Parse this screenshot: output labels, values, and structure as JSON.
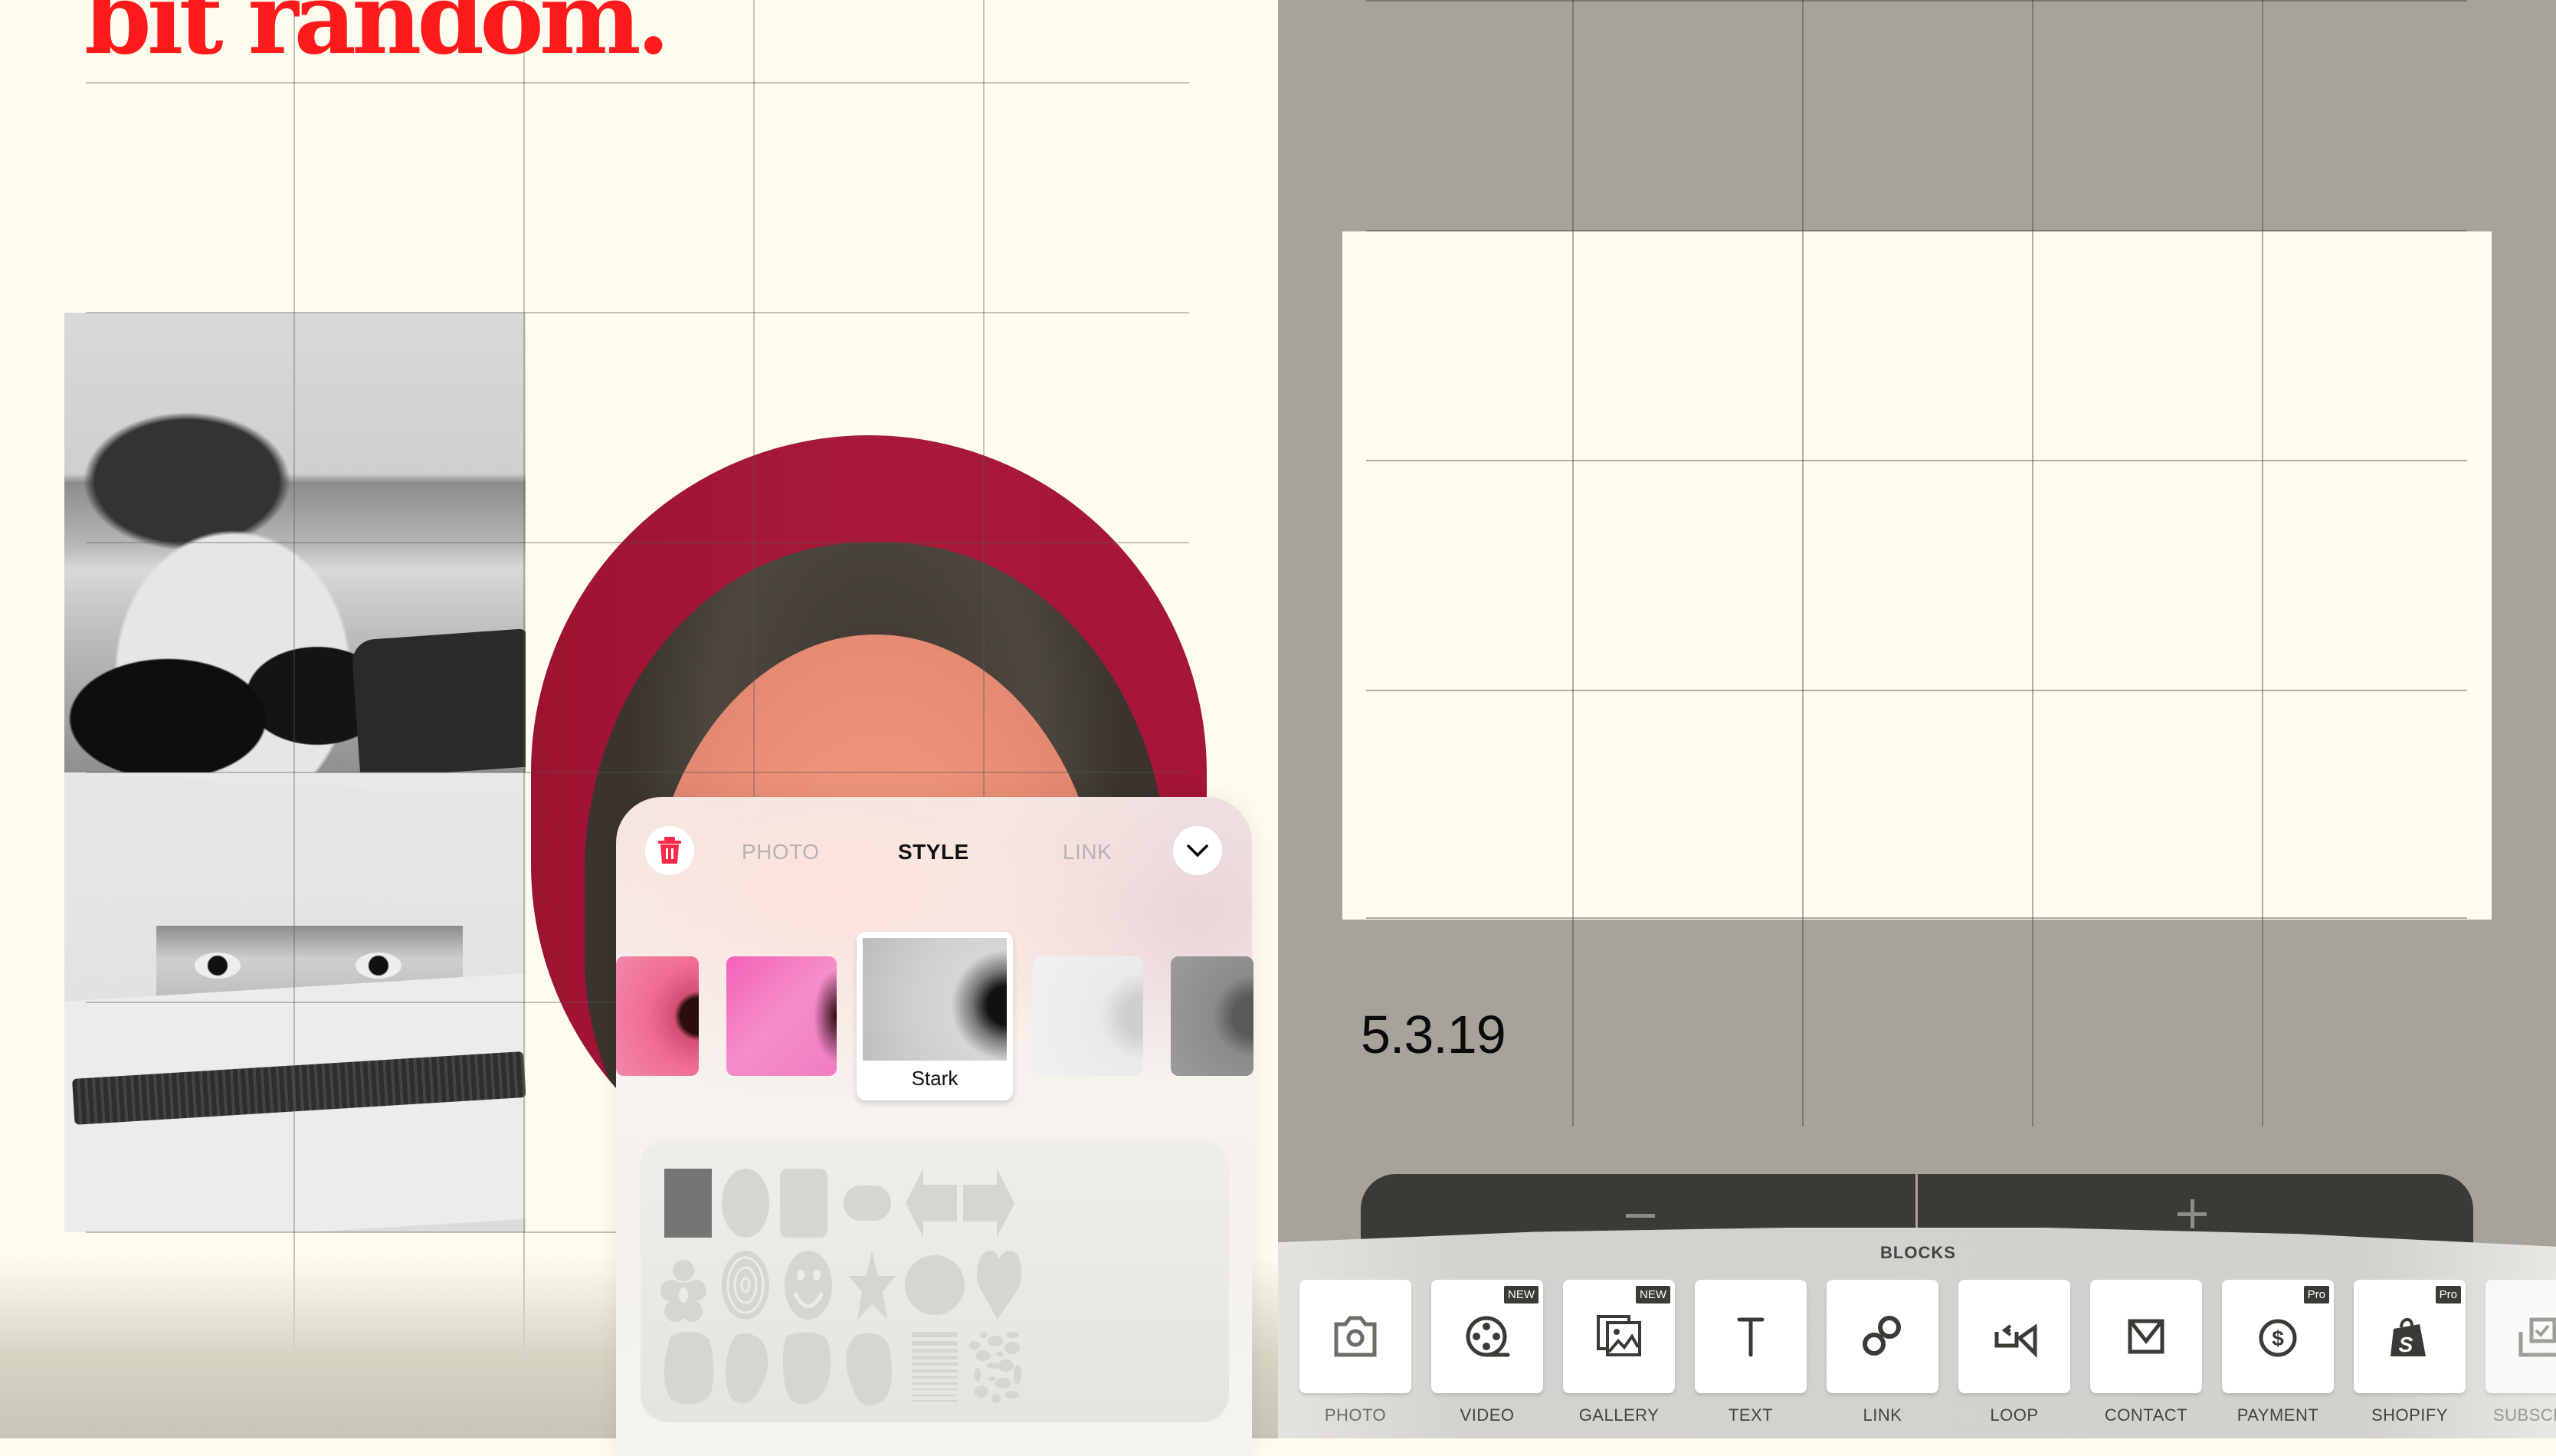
{
  "canvas": {
    "headline": "bit random.",
    "accent_color": "#ff1a1c"
  },
  "style_panel": {
    "tabs": [
      {
        "label": "PHOTO",
        "active": false
      },
      {
        "label": "STYLE",
        "active": true
      },
      {
        "label": "LINK",
        "active": false
      }
    ],
    "trash_icon": "trash-icon",
    "collapse_icon": "chevron-down-icon",
    "filters": [
      {
        "name": "",
        "tone": "pink"
      },
      {
        "name": "",
        "tone": "blur-pink"
      },
      {
        "name": "Stark",
        "tone": "grayscale",
        "selected": true
      },
      {
        "name": "",
        "tone": "faded"
      },
      {
        "name": "",
        "tone": "dark-gray"
      }
    ],
    "shapes": [
      "rectangle",
      "oval",
      "rounded-rectangle",
      "pill",
      "arrow-left",
      "arrow-right",
      "flower",
      "target",
      "smiley",
      "star",
      "starburst",
      "heart",
      "blob-1",
      "blob-2",
      "blob-3",
      "blob-4",
      "stripes",
      "pebbles"
    ],
    "selected_shape": "rectangle"
  },
  "right_panel": {
    "date": "5.3.19",
    "stepper": {
      "minus_label": "−",
      "plus_label": "+"
    }
  },
  "blocks": {
    "title": "BLOCKS",
    "items": [
      {
        "label": "PHOTO",
        "icon": "camera-icon",
        "badge": ""
      },
      {
        "label": "VIDEO",
        "icon": "film-reel-icon",
        "badge": "NEW"
      },
      {
        "label": "GALLERY",
        "icon": "gallery-icon",
        "badge": "NEW"
      },
      {
        "label": "TEXT",
        "icon": "text-icon",
        "badge": ""
      },
      {
        "label": "LINK",
        "icon": "link-icon",
        "badge": ""
      },
      {
        "label": "LOOP",
        "icon": "loop-icon",
        "badge": ""
      },
      {
        "label": "CONTACT",
        "icon": "mail-icon",
        "badge": ""
      },
      {
        "label": "PAYMENT",
        "icon": "dollar-icon",
        "badge": "Pro"
      },
      {
        "label": "SHOPIFY",
        "icon": "shopify-icon",
        "badge": "Pro"
      },
      {
        "label": "SUBSCR",
        "icon": "subscribe-icon",
        "badge": ""
      }
    ]
  }
}
